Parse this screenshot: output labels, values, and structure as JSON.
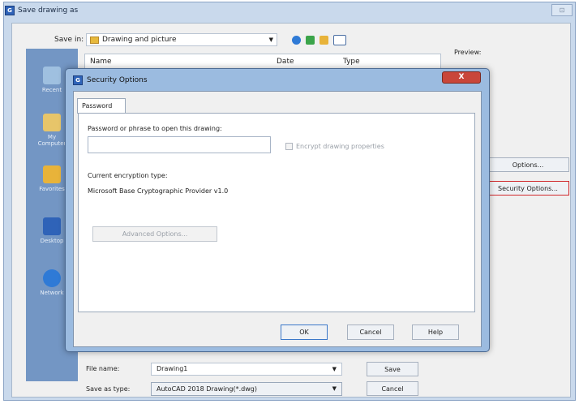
{
  "outer": {
    "title": "Save drawing as",
    "close_glyph": "⊡"
  },
  "toolbar": {
    "save_in_label": "Save in:",
    "save_in_value": "Drawing and picture",
    "icons": [
      "back-icon",
      "up-folder-icon",
      "new-folder-icon",
      "views-icon"
    ]
  },
  "file_list": {
    "columns": [
      "Name",
      "Date",
      "Type"
    ]
  },
  "preview_label": "Preview:",
  "places": [
    {
      "label": "Recent"
    },
    {
      "label": "My Computer"
    },
    {
      "label": "Favorites"
    },
    {
      "label": "Desktop"
    },
    {
      "label": "Network"
    }
  ],
  "side_buttons": {
    "options": "Options...",
    "security_options": "Security Options..."
  },
  "bottom": {
    "file_name_label": "File name:",
    "file_name_value": "Drawing1",
    "save_as_type_label": "Save as type:",
    "save_as_type_value": "AutoCAD 2018 Drawing(*.dwg)",
    "save_button": "Save",
    "cancel_button": "Cancel"
  },
  "dialog": {
    "title": "Security Options",
    "close_glyph": "X",
    "tab": "Password",
    "password_label": "Password or phrase to open this drawing:",
    "password_value": "",
    "encrypt_label": "Encrypt drawing properties",
    "encryption_type_label": "Current encryption type:",
    "encryption_provider": "Microsoft Base Cryptographic Provider v1.0",
    "advanced_button": "Advanced Options...",
    "ok_button": "OK",
    "cancel_button": "Cancel",
    "help_button": "Help"
  },
  "colors": {
    "highlight": "#d0282c",
    "accent": "#3b78c9"
  }
}
